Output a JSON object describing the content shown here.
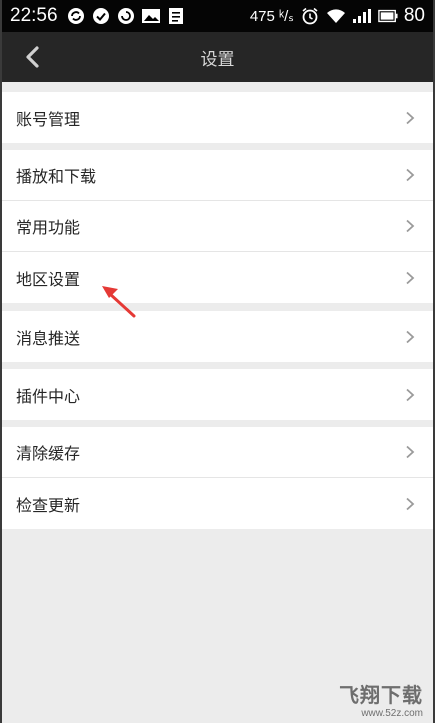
{
  "status_bar": {
    "time": "22:56",
    "speed": "475 ᵏ/ₛ",
    "battery": "80"
  },
  "header": {
    "title": "设置"
  },
  "settings": {
    "groups": [
      {
        "items": [
          {
            "label": "账号管理"
          }
        ]
      },
      {
        "items": [
          {
            "label": "播放和下载"
          },
          {
            "label": "常用功能"
          },
          {
            "label": "地区设置"
          }
        ]
      },
      {
        "items": [
          {
            "label": "消息推送"
          }
        ]
      },
      {
        "items": [
          {
            "label": "插件中心"
          }
        ]
      },
      {
        "items": [
          {
            "label": "清除缓存"
          },
          {
            "label": "检查更新"
          }
        ]
      }
    ]
  },
  "watermark": {
    "main": "飞翔下载",
    "sub": "www.52z.com"
  },
  "colors": {
    "status_bg": "#050505",
    "titlebar_bg": "#262626",
    "page_bg": "#ececec",
    "annotation_arrow": "#e53935"
  }
}
